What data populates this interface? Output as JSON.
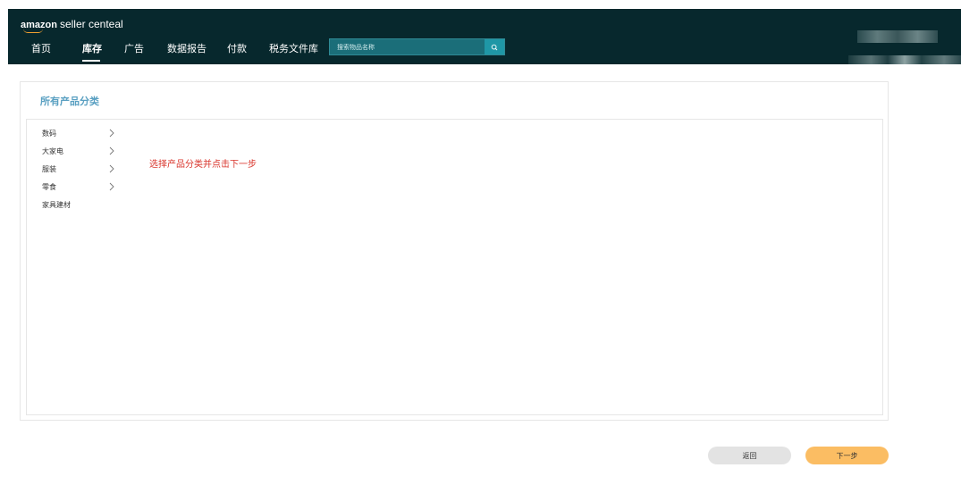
{
  "header": {
    "logo_brand": "amazon",
    "logo_rest": "seller centeal",
    "nav": [
      {
        "label": "首页",
        "active": false
      },
      {
        "label": "库存",
        "active": true
      },
      {
        "label": "广告",
        "active": false
      },
      {
        "label": "数据报告",
        "active": false
      },
      {
        "label": "付款",
        "active": false
      },
      {
        "label": "税务文件库",
        "active": false
      }
    ],
    "search": {
      "placeholder": "搜索物品名称",
      "icon": "search-icon"
    }
  },
  "main": {
    "title": "所有产品分类",
    "categories": [
      {
        "label": "数码",
        "has_children": true
      },
      {
        "label": "大家电",
        "has_children": true
      },
      {
        "label": "服装",
        "has_children": true
      },
      {
        "label": "零食",
        "has_children": true
      },
      {
        "label": "家具建材",
        "has_children": false
      }
    ],
    "hint": "选择产品分类并点击下一步"
  },
  "footer": {
    "back_label": "返回",
    "next_label": "下一步"
  },
  "colors": {
    "header_bg": "#07282d",
    "title_accent": "#5aa0c2",
    "hint_red": "#d9342b",
    "next_button": "#fbbd63",
    "back_button": "#e3e3e3"
  }
}
